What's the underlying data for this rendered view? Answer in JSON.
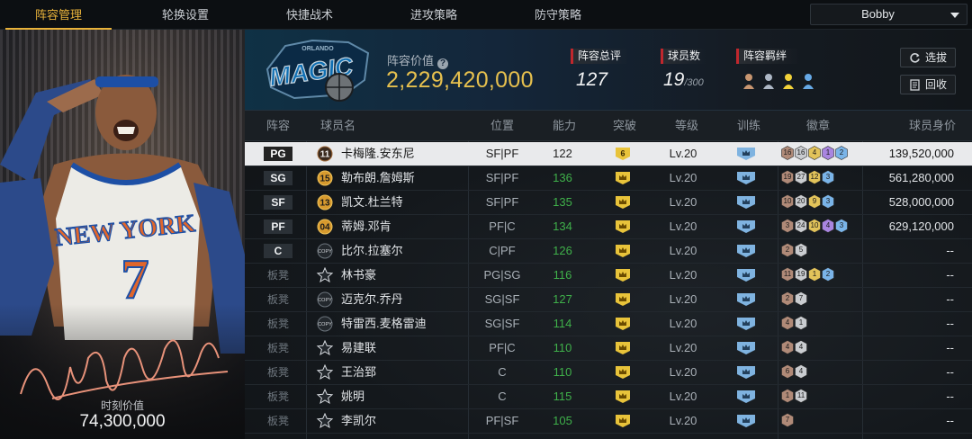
{
  "nav": {
    "tabs": [
      {
        "label": "阵容管理",
        "active": true
      },
      {
        "label": "轮换设置",
        "active": false
      },
      {
        "label": "快捷战术",
        "active": false
      },
      {
        "label": "进攻策略",
        "active": false
      },
      {
        "label": "防守策略",
        "active": false
      }
    ],
    "user_dropdown": "Bobby"
  },
  "card": {
    "jersey_team": "NEW YORK",
    "jersey_number": "7",
    "market_value_label": "时刻价值",
    "market_value": "74,300,000"
  },
  "team": {
    "logo_text": "MAGIC",
    "logo_city": "ORLANDO",
    "value_label": "阵容价值",
    "value": "2,229,420,000",
    "rating_label": "阵容总评",
    "rating": "127",
    "count_label": "球员数",
    "count": "19",
    "count_max": "/300",
    "chem_label": "阵容羁绊",
    "select_btn": "选拔",
    "recycle_btn": "回收"
  },
  "table": {
    "headers": [
      "阵容",
      "球员名",
      "位置",
      "能力",
      "突破",
      "等级",
      "训练",
      "徽章",
      "球员身价"
    ],
    "rows": [
      {
        "slot": "PG",
        "bench": false,
        "num": "11",
        "numStyle": "circle",
        "name": "卡梅隆.安东尼",
        "pos": "SF|PF",
        "ability": "122",
        "breakthrough": "6",
        "level": "Lv.20",
        "badges": [
          [
            "16",
            "bronze"
          ],
          [
            "16",
            "silver"
          ],
          [
            "4",
            "gold"
          ],
          [
            "1",
            "purple"
          ],
          [
            "2",
            "blue"
          ]
        ],
        "value": "139,520,000",
        "selected": true
      },
      {
        "slot": "SG",
        "bench": false,
        "num": "15",
        "numStyle": "circle",
        "name": "勒布朗.詹姆斯",
        "pos": "SF|PF",
        "ability": "136",
        "breakthrough": "",
        "level": "Lv.20",
        "badges": [
          [
            "19",
            "bronze"
          ],
          [
            "27",
            "silver"
          ],
          [
            "12",
            "gold"
          ],
          [
            "3",
            "blue"
          ]
        ],
        "value": "561,280,000",
        "selected": false
      },
      {
        "slot": "SF",
        "bench": false,
        "num": "13",
        "numStyle": "circle",
        "name": "凯文.杜兰特",
        "pos": "SF|PF",
        "ability": "135",
        "breakthrough": "",
        "level": "Lv.20",
        "badges": [
          [
            "10",
            "bronze"
          ],
          [
            "20",
            "silver"
          ],
          [
            "9",
            "gold"
          ],
          [
            "3",
            "blue"
          ]
        ],
        "value": "528,000,000",
        "selected": false
      },
      {
        "slot": "PF",
        "bench": false,
        "num": "04",
        "numStyle": "circle",
        "name": "蒂姆.邓肯",
        "pos": "PF|C",
        "ability": "134",
        "breakthrough": "",
        "level": "Lv.20",
        "badges": [
          [
            "3",
            "bronze"
          ],
          [
            "24",
            "silver"
          ],
          [
            "10",
            "gold"
          ],
          [
            "4",
            "purple"
          ],
          [
            "3",
            "blue"
          ]
        ],
        "value": "629,120,000",
        "selected": false
      },
      {
        "slot": "C",
        "bench": false,
        "num": "COPY",
        "numStyle": "copy",
        "name": "比尔.拉塞尔",
        "pos": "C|PF",
        "ability": "126",
        "breakthrough": "",
        "level": "Lv.20",
        "badges": [
          [
            "2",
            "bronze"
          ],
          [
            "5",
            "silver"
          ]
        ],
        "value": "--",
        "selected": false
      },
      {
        "slot": "板凳",
        "bench": true,
        "num": "",
        "numStyle": "star",
        "name": "林书豪",
        "pos": "PG|SG",
        "ability": "116",
        "breakthrough": "",
        "level": "Lv.20",
        "badges": [
          [
            "11",
            "bronze"
          ],
          [
            "19",
            "silver"
          ],
          [
            "1",
            "gold"
          ],
          [
            "2",
            "blue"
          ]
        ],
        "value": "--",
        "selected": false
      },
      {
        "slot": "板凳",
        "bench": true,
        "num": "COPY",
        "numStyle": "copy",
        "name": "迈克尔.乔丹",
        "pos": "SG|SF",
        "ability": "127",
        "breakthrough": "",
        "level": "Lv.20",
        "badges": [
          [
            "2",
            "bronze"
          ],
          [
            "7",
            "silver"
          ]
        ],
        "value": "--",
        "selected": false
      },
      {
        "slot": "板凳",
        "bench": true,
        "num": "COPY",
        "numStyle": "copy",
        "name": "特雷西.麦格雷迪",
        "pos": "SG|SF",
        "ability": "114",
        "breakthrough": "",
        "level": "Lv.20",
        "badges": [
          [
            "4",
            "bronze"
          ],
          [
            "1",
            "silver"
          ]
        ],
        "value": "--",
        "selected": false
      },
      {
        "slot": "板凳",
        "bench": true,
        "num": "",
        "numStyle": "star",
        "name": "易建联",
        "pos": "PF|C",
        "ability": "110",
        "breakthrough": "",
        "level": "Lv.20",
        "badges": [
          [
            "4",
            "bronze"
          ],
          [
            "4",
            "silver"
          ]
        ],
        "value": "--",
        "selected": false
      },
      {
        "slot": "板凳",
        "bench": true,
        "num": "",
        "numStyle": "star",
        "name": "王治郅",
        "pos": "C",
        "ability": "110",
        "breakthrough": "",
        "level": "Lv.20",
        "badges": [
          [
            "6",
            "bronze"
          ],
          [
            "4",
            "silver"
          ]
        ],
        "value": "--",
        "selected": false
      },
      {
        "slot": "板凳",
        "bench": true,
        "num": "",
        "numStyle": "star",
        "name": "姚明",
        "pos": "C",
        "ability": "115",
        "breakthrough": "",
        "level": "Lv.20",
        "badges": [
          [
            "1",
            "bronze"
          ],
          [
            "11",
            "silver"
          ]
        ],
        "value": "--",
        "selected": false
      },
      {
        "slot": "板凳",
        "bench": true,
        "num": "",
        "numStyle": "star",
        "name": "李凯尔",
        "pos": "PF|SF",
        "ability": "105",
        "breakthrough": "",
        "level": "Lv.20",
        "badges": [
          [
            "7",
            "bronze"
          ]
        ],
        "value": "--",
        "selected": false
      }
    ]
  },
  "colors": {
    "gold_accent": "#e8b23a",
    "team_value": "#e6c04e",
    "ability_green": "#3fb04a",
    "red_marker": "#c0272d",
    "badge_bronze": "#b08a78",
    "badge_silver": "#c9ccd0",
    "badge_gold": "#e2c35a",
    "badge_purple": "#a985e0",
    "badge_blue": "#7ab4e8"
  }
}
